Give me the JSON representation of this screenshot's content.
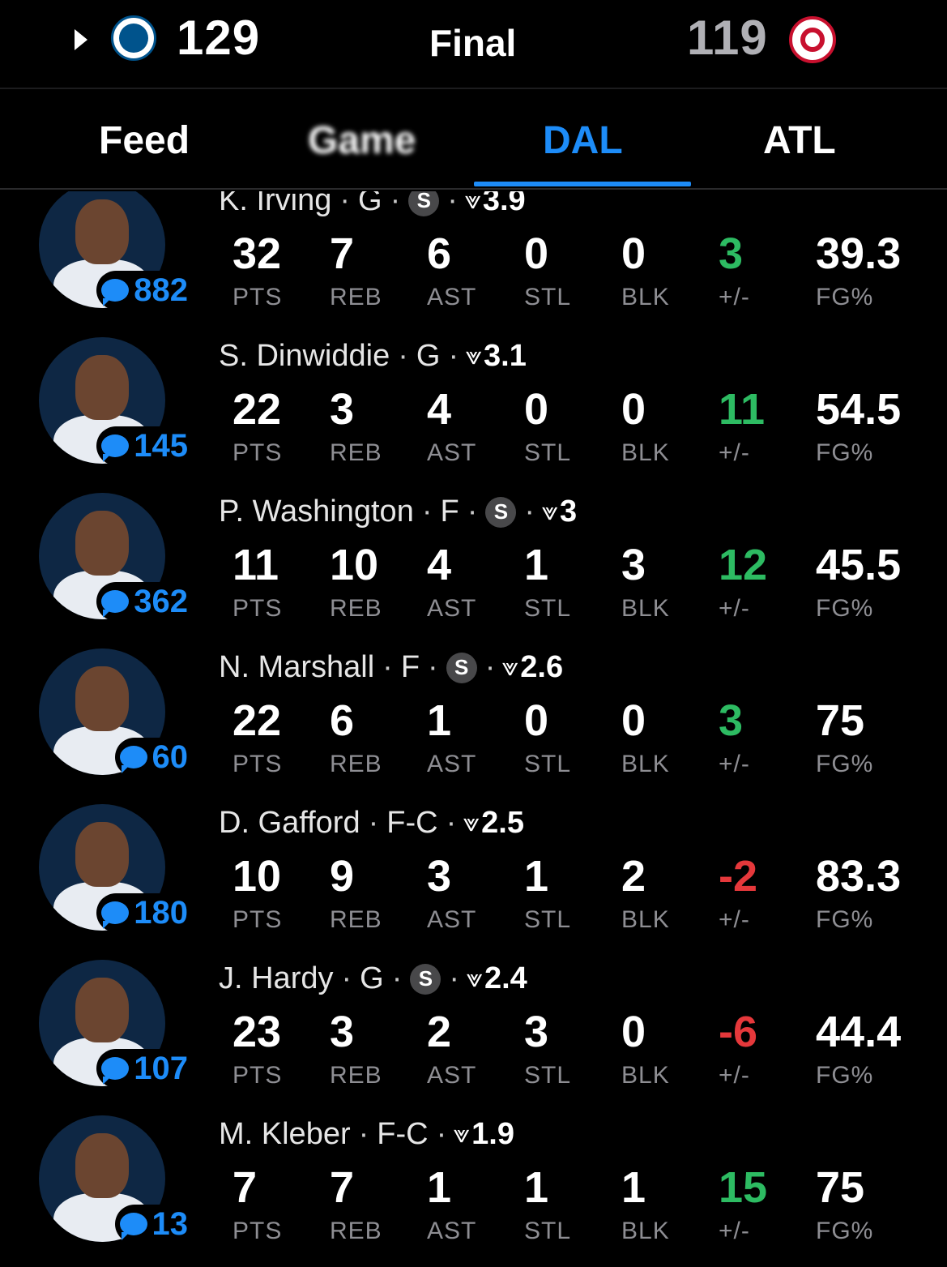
{
  "header": {
    "home_score": "129",
    "status": "Final",
    "away_score": "119",
    "home_logo": "mavericks-logo",
    "away_logo": "hawks-logo",
    "colors": {
      "accent": "#1d8cf8",
      "positive": "#2dbb62",
      "negative": "#e5383b"
    }
  },
  "tabs": [
    {
      "label": "Feed"
    },
    {
      "label": "Game"
    },
    {
      "label": "DAL"
    },
    {
      "label": "ATL"
    }
  ],
  "stat_labels": {
    "pts": "PTS",
    "reb": "REB",
    "ast": "AST",
    "stl": "STL",
    "blk": "BLK",
    "pm": "+/-",
    "fg": "FG%"
  },
  "players": [
    {
      "name": "K. Irving",
      "pos": "G",
      "starter": true,
      "starter_label": "S",
      "rating": "3.9",
      "comments": "882",
      "pts": "32",
      "reb": "7",
      "ast": "6",
      "stl": "0",
      "blk": "0",
      "pm": "3",
      "fg": "39.3"
    },
    {
      "name": "S. Dinwiddie",
      "pos": "G",
      "starter": false,
      "rating": "3.1",
      "comments": "145",
      "pts": "22",
      "reb": "3",
      "ast": "4",
      "stl": "0",
      "blk": "0",
      "pm": "11",
      "fg": "54.5"
    },
    {
      "name": "P. Washington",
      "pos": "F",
      "starter": true,
      "starter_label": "S",
      "rating": "3",
      "comments": "362",
      "pts": "11",
      "reb": "10",
      "ast": "4",
      "stl": "1",
      "blk": "3",
      "pm": "12",
      "fg": "45.5"
    },
    {
      "name": "N. Marshall",
      "pos": "F",
      "starter": true,
      "starter_label": "S",
      "rating": "2.6",
      "comments": "60",
      "pts": "22",
      "reb": "6",
      "ast": "1",
      "stl": "0",
      "blk": "0",
      "pm": "3",
      "fg": "75"
    },
    {
      "name": "D. Gafford",
      "pos": "F-C",
      "starter": false,
      "rating": "2.5",
      "comments": "180",
      "pts": "10",
      "reb": "9",
      "ast": "3",
      "stl": "1",
      "blk": "2",
      "pm": "-2",
      "fg": "83.3"
    },
    {
      "name": "J. Hardy",
      "pos": "G",
      "starter": true,
      "starter_label": "S",
      "rating": "2.4",
      "comments": "107",
      "pts": "23",
      "reb": "3",
      "ast": "2",
      "stl": "3",
      "blk": "0",
      "pm": "-6",
      "fg": "44.4"
    },
    {
      "name": "M. Kleber",
      "pos": "F-C",
      "starter": false,
      "rating": "1.9",
      "comments": "13",
      "pts": "7",
      "reb": "7",
      "ast": "1",
      "stl": "1",
      "blk": "1",
      "pm": "15",
      "fg": "75"
    }
  ]
}
